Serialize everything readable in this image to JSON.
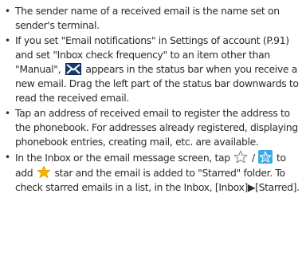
{
  "bullets": [
    {
      "text": "The sender name of a received email is the name set on sender's terminal."
    },
    {
      "text_before_icon": "If you set \"Email notifications\" in Settings of account (P.91) and set \"Inbox check frequency\" to an item other than \"Manual\",",
      "icon": "mail-icon",
      "text_after_icon": "appears in the status bar when you receive a new email. Drag the left part of the status bar downwards to read the received email."
    },
    {
      "text": "Tap an address of received email to register the address to the phonebook. For addresses already registered, displaying phonebook entries, creating mail, etc. are available."
    },
    {
      "text_part1": "In the Inbox or the email message screen, tap",
      "icon_outline": "star-outline-icon",
      "text_separator": "/",
      "icon_blue": "star-blue-icon",
      "text_part2": "to add",
      "icon_yellow": "star-yellow-icon",
      "text_part3": "star and the email is added to \"Starred\" folder. To check starred emails in a list, in the Inbox, [Inbox]▶[Starred]."
    }
  ],
  "colors": {
    "text": "#2b2b2b",
    "mail_icon_fill": "#1a3a6e",
    "star_blue": "#3aa9e0",
    "star_yellow": "#f5b400",
    "star_outline": "#8a8a8a"
  }
}
